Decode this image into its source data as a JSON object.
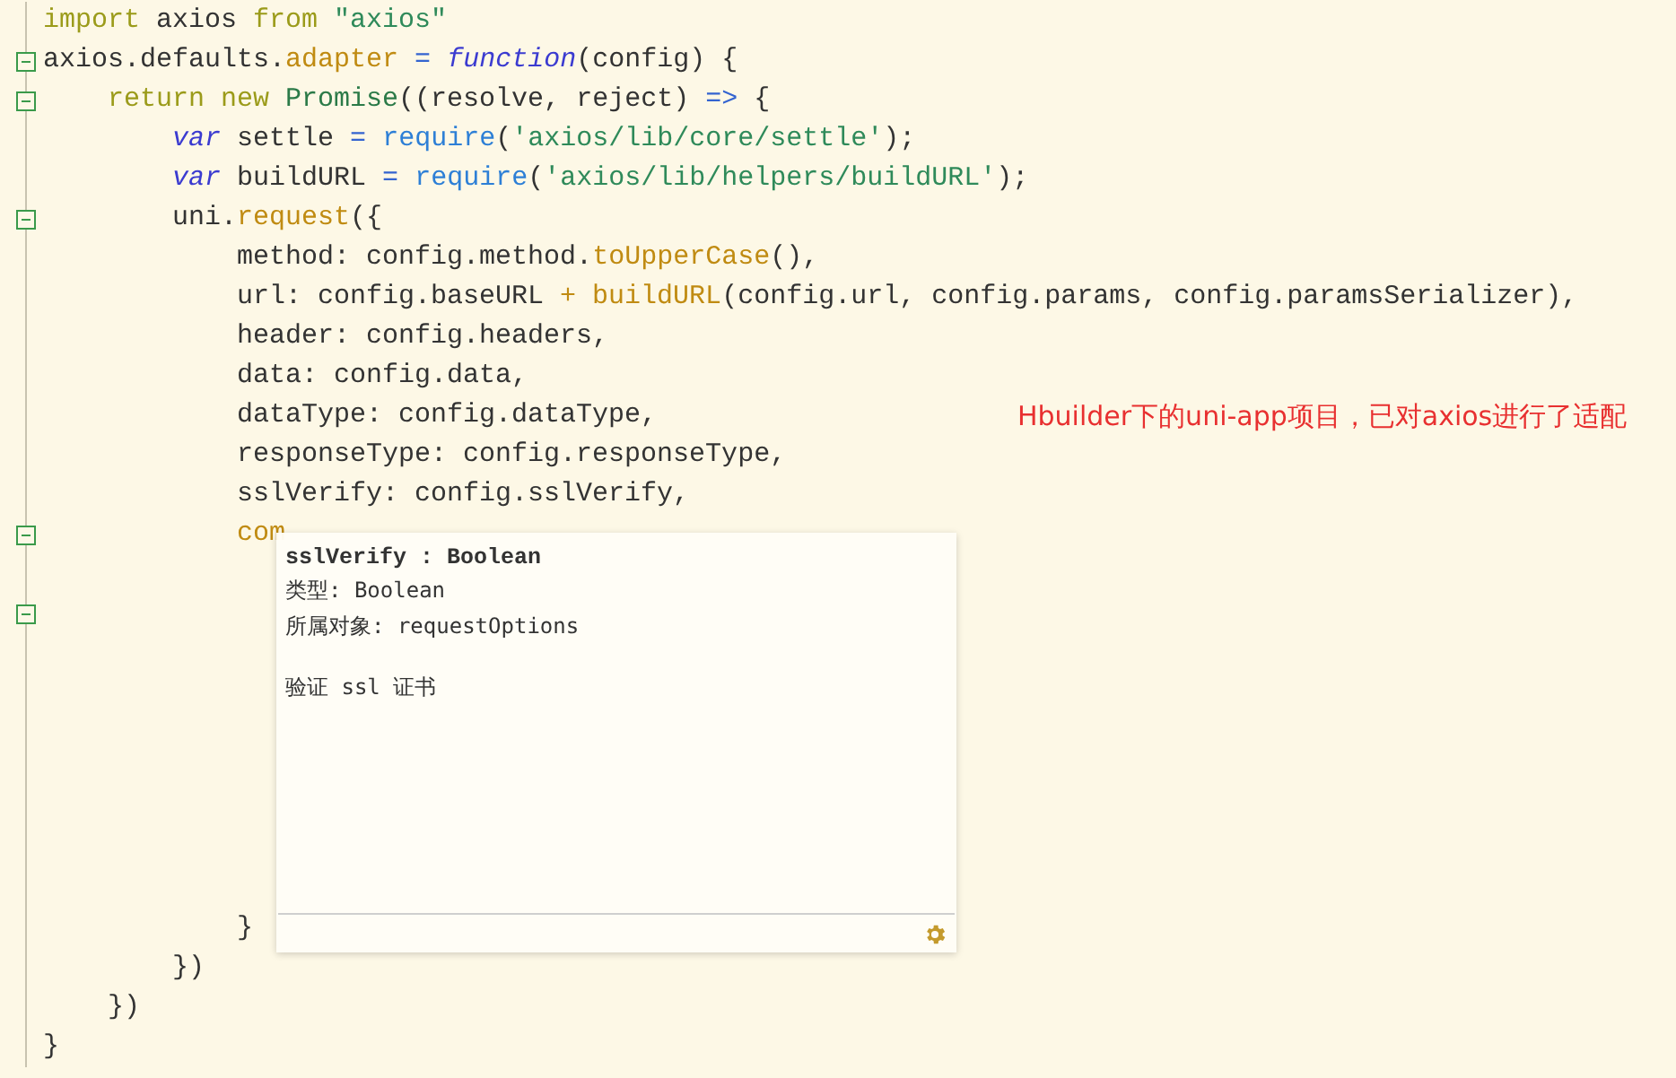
{
  "editor": {
    "lines": [
      {
        "fold": false,
        "tokens": [
          {
            "kind": "keyword",
            "text": "import"
          },
          {
            "kind": "plain",
            "text": " axios "
          },
          {
            "kind": "keyword",
            "text": "from"
          },
          {
            "kind": "string",
            "text": " \"axios\""
          }
        ]
      },
      {
        "fold": true,
        "tokens": [
          {
            "kind": "plain",
            "text": "axios.defaults."
          },
          {
            "kind": "property",
            "text": "adapter"
          },
          {
            "kind": "operator",
            "text": " ="
          },
          {
            "kind": "storage",
            "text": " function"
          },
          {
            "kind": "plain",
            "text": "(config) {"
          }
        ]
      },
      {
        "fold": true,
        "tokens": [
          {
            "kind": "keyword",
            "text": "    return"
          },
          {
            "kind": "keyword",
            "text": " new"
          },
          {
            "kind": "class",
            "text": " Promise"
          },
          {
            "kind": "plain",
            "text": "((resolve, reject) "
          },
          {
            "kind": "operator",
            "text": "=>"
          },
          {
            "kind": "plain",
            "text": " {"
          }
        ]
      },
      {
        "fold": false,
        "tokens": [
          {
            "kind": "storage",
            "text": "        var"
          },
          {
            "kind": "plain",
            "text": " settle "
          },
          {
            "kind": "operator",
            "text": "="
          },
          {
            "kind": "function",
            "text": " require"
          },
          {
            "kind": "plain",
            "text": "("
          },
          {
            "kind": "string",
            "text": "'axios/lib/core/settle'"
          },
          {
            "kind": "plain",
            "text": ");"
          }
        ]
      },
      {
        "fold": false,
        "tokens": [
          {
            "kind": "storage",
            "text": "        var"
          },
          {
            "kind": "plain",
            "text": " buildURL "
          },
          {
            "kind": "operator",
            "text": "="
          },
          {
            "kind": "function",
            "text": " require"
          },
          {
            "kind": "plain",
            "text": "("
          },
          {
            "kind": "string",
            "text": "'axios/lib/helpers/buildURL'"
          },
          {
            "kind": "plain",
            "text": ");"
          }
        ]
      },
      {
        "fold": true,
        "tokens": [
          {
            "kind": "plain",
            "text": "        uni."
          },
          {
            "kind": "property",
            "text": "request"
          },
          {
            "kind": "plain",
            "text": "({"
          }
        ]
      },
      {
        "fold": false,
        "tokens": [
          {
            "kind": "plain",
            "text": "            method: config.method."
          },
          {
            "kind": "property",
            "text": "toUpperCase"
          },
          {
            "kind": "plain",
            "text": "(),"
          }
        ]
      },
      {
        "fold": false,
        "tokens": [
          {
            "kind": "plain",
            "text": "            url: config.baseURL "
          },
          {
            "kind": "property",
            "text": "+ buildURL"
          },
          {
            "kind": "plain",
            "text": "(config.url, config.params, config.paramsSerializer),"
          }
        ]
      },
      {
        "fold": false,
        "tokens": [
          {
            "kind": "plain",
            "text": "            header: config.headers,"
          }
        ]
      },
      {
        "fold": false,
        "tokens": [
          {
            "kind": "plain",
            "text": "            data: config.data,"
          }
        ]
      },
      {
        "fold": false,
        "tokens": [
          {
            "kind": "plain",
            "text": "            dataType: config.dataType,"
          }
        ],
        "annotation": "Hbuilder下的uni-app项目，已对axios进行了适配"
      },
      {
        "fold": false,
        "tokens": [
          {
            "kind": "plain",
            "text": "            responseType: config.responseType,"
          }
        ]
      },
      {
        "fold": false,
        "tokens": [
          {
            "kind": "plain",
            "text": "            sslVerify: config.sslVerify,"
          }
        ]
      },
      {
        "fold": true,
        "tokens": [
          {
            "kind": "property",
            "text": "            com"
          }
        ]
      },
      {
        "fold": false
      },
      {
        "fold": true
      },
      {
        "fold": false
      },
      {
        "fold": false
      },
      {
        "fold": false
      },
      {
        "fold": false
      },
      {
        "fold": false
      },
      {
        "fold": false
      },
      {
        "fold": false
      },
      {
        "fold": false,
        "tokens": [
          {
            "kind": "plain",
            "text": "            }"
          }
        ]
      },
      {
        "fold": false,
        "tokens": [
          {
            "kind": "plain",
            "text": "        })"
          }
        ]
      },
      {
        "fold": false,
        "tokens": [
          {
            "kind": "plain",
            "text": "    })"
          }
        ]
      },
      {
        "fold": false,
        "tokens": [
          {
            "kind": "plain",
            "text": "}"
          }
        ]
      }
    ]
  },
  "tooltip": {
    "title": "sslVerify : Boolean",
    "lines": [
      "类型: Boolean",
      "所属对象: requestOptions"
    ],
    "description": "验证 ssl 证书"
  }
}
